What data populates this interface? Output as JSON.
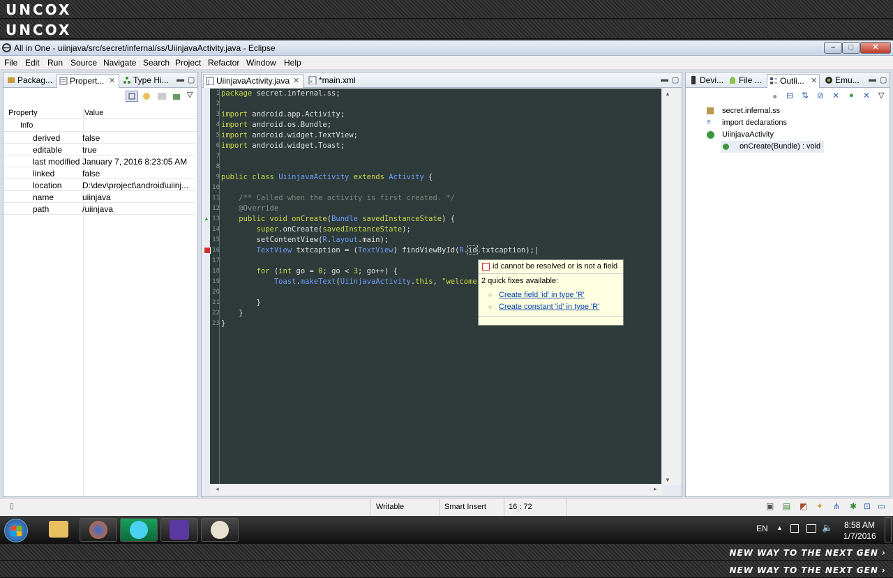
{
  "banners": {
    "logo": "UNCOX",
    "tagline": "NEW WAY TO THE NEXT GEN ›"
  },
  "window": {
    "title": "All in One - uiinjava/src/secret/infernal/ss/UiinjavaActivity.java - Eclipse",
    "min": "–",
    "max": "□",
    "close": "✕"
  },
  "menu": [
    "File",
    "Edit",
    "Run",
    "Source",
    "Navigate",
    "Search",
    "Project",
    "Refactor",
    "Window",
    "Help"
  ],
  "left_panel": {
    "tabs": [
      "Packag...",
      "Propert...",
      "Type Hi..."
    ],
    "columns": [
      "Property",
      "Value"
    ],
    "group": "Info",
    "rows": [
      {
        "k": "derived",
        "v": "false"
      },
      {
        "k": "editable",
        "v": "true"
      },
      {
        "k": "last modified",
        "v": "January 7, 2016 8:23:05 AM"
      },
      {
        "k": "linked",
        "v": "false"
      },
      {
        "k": "location",
        "v": "D:\\dev\\project\\android\\uiinj..."
      },
      {
        "k": "name",
        "v": "uiinjava"
      },
      {
        "k": "path",
        "v": "/uiinjava"
      }
    ]
  },
  "editor": {
    "tabs": [
      "UiinjavaActivity.java",
      "*main.xml"
    ],
    "line_numbers": [
      "1",
      "2",
      "3",
      "4",
      "5",
      "6",
      "7",
      "8",
      "9",
      "10",
      "11",
      "12",
      "13",
      "14",
      "15",
      "16",
      "17",
      "18",
      "19",
      "20",
      "21",
      "22",
      "23"
    ]
  },
  "tooltip": {
    "error": "id cannot be resolved or is not a field",
    "fixes_count": "2 quick fixes available:",
    "fix1": "Create field 'id' in type 'R'",
    "fix2": "Create constant 'id' in type 'R'"
  },
  "right_panel": {
    "tabs": [
      "Devi...",
      "File ...",
      "Outli...",
      "Emu..."
    ],
    "outline": [
      "secret.infernal.ss",
      "import declarations",
      "UiinjavaActivity",
      "onCreate(Bundle) : void"
    ]
  },
  "status": {
    "writable": "Writable",
    "insert_mode": "Smart Insert",
    "position": "16 : 72"
  },
  "taskbar": {
    "lang": "EN",
    "time": "8:58 AM",
    "date": "1/7/2016"
  }
}
